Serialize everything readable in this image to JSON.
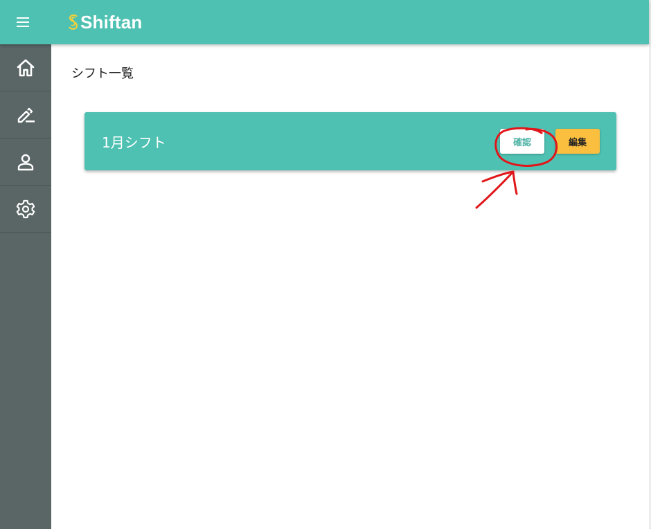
{
  "header": {
    "app_name": "Shiftan",
    "menu_icon": "hamburger-menu-icon",
    "background_color": "#4fc1b2"
  },
  "sidebar": {
    "background_color": "#5a6566",
    "items": [
      {
        "icon": "home-icon"
      },
      {
        "icon": "edit-pen-icon"
      },
      {
        "icon": "person-icon"
      },
      {
        "icon": "gear-icon"
      }
    ]
  },
  "main": {
    "page_title": "シフト一覧",
    "shifts": [
      {
        "name": "1月シフト",
        "confirm_label": "確認",
        "edit_label": "編集"
      }
    ]
  },
  "colors": {
    "accent": "#4fc1b2",
    "edit_button": "#fbbf3f",
    "annotation": "#e0161a"
  }
}
